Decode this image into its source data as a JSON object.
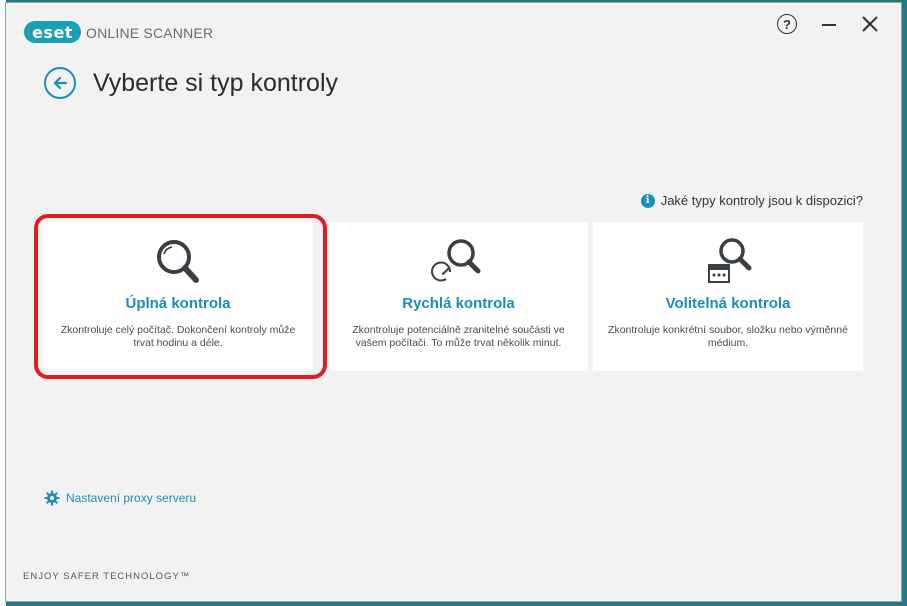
{
  "window": {
    "logo_text": "eset",
    "app_name": "ONLINE SCANNER",
    "help_icon": "?",
    "close_icon": "✕"
  },
  "header": {
    "title": "Vyberte si typ kontroly"
  },
  "info": {
    "label": "Jaké typy kontroly jsou k dispozici?",
    "icon_glyph": "i"
  },
  "cards": [
    {
      "title": "Úplná kontrola",
      "description": "Zkontroluje celý počítač. Dokončení kontroly může trvat hodinu a déle.",
      "icon": "magnifier-icon",
      "selected": true
    },
    {
      "title": "Rychlá kontrola",
      "description": "Zkontroluje potenciálně zranitelné součásti ve vašem počítači. To může trvat několik minut.",
      "icon": "quick-scan-icon",
      "selected": false
    },
    {
      "title": "Volitelná kontrola",
      "description": "Zkontroluje konkrétní soubor, složku nebo výměnné médium.",
      "icon": "custom-scan-icon",
      "selected": false
    }
  ],
  "footer": {
    "proxy_label": "Nastavení proxy serveru",
    "tagline": "ENJOY SAFER TECHNOLOGY™"
  },
  "colors": {
    "accent": "#1a8fb5",
    "highlight": "#e31c23",
    "background": "#f2f2f2",
    "card": "#ffffff"
  }
}
